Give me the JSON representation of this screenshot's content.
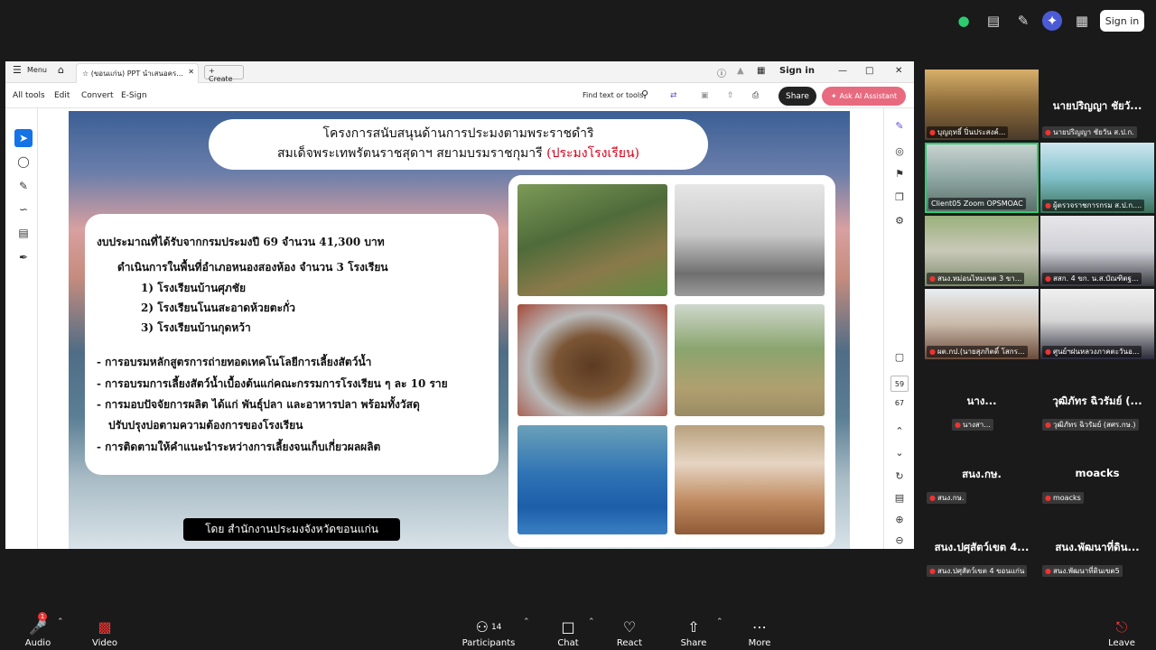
{
  "zoom_top": {
    "sign_in": "Sign in"
  },
  "acrobat": {
    "menu": "Menu",
    "tab_title": "(ขอนแก่น) PPT นำเสนอคร...",
    "create": "Create",
    "sign_in": "Sign in",
    "all_tools": "All tools",
    "edit": "Edit",
    "convert": "Convert",
    "esign": "E-Sign",
    "find": "Find text or tools",
    "share": "Share",
    "ai_assistant": "Ask AI Assistant",
    "page_number": "59",
    "page_total": "67"
  },
  "slide": {
    "title_line1": "โครงการสนับสนุนด้านการประมงตามพระราชดำริ",
    "title_line2": "สมเด็จพระเทพรัตนราชสุดาฯ สยามบรมราชกุมารี",
    "title_red": "(ประมงโรงเรียน)",
    "budget": "งบประมาณที่ได้รับจากกรมประมงปี 69  จำนวน 41,300 บาท",
    "area": "ดำเนินการในพื้นที่อำเภอหนองสองห้อง จำนวน 3 โรงเรียน",
    "school1": "1) โรงเรียนบ้านศุภชัย",
    "school2": "2) โรงเรียนโนนสะอาดห้วยตะกั่ว",
    "school3": "3) โรงเรียนบ้านกุดหว้า",
    "act1": "- การอบรมหลักสูตรการถ่ายทอดเทคโนโลยีการเลี้ยงสัตว์น้ำ",
    "act2": "- การอบรมการเลี้ยงสัตว์น้ำเบื้องต้นแก่คณะกรรมการโรงเรียน ๆ ละ 10 ราย",
    "act3": "- การมอบปัจจัยการผลิต ได้แก่ พันธุ์ปลา และอาหารปลา พร้อมทั้งวัสดุ",
    "act3b": "ปรับปรุงบ่อตามความต้องการของโรงเรียน",
    "act4": "- การติดตามให้คำแนะนำระหว่างการเลี้ยงจนเก็บเกี่ยวผลผลิต",
    "credit": "โดย สำนักงานประมงจังหวัดขอนแก่น"
  },
  "participants": [
    {
      "label": "บุญฤทธิ์ ปิ่นประสงค์..."
    },
    {
      "big": "นายปริญญา ชัยวั...",
      "label": "นายปริญญา ชัยวัน ส.ป.ก."
    },
    {
      "label": "Client05 Zoom OPSMOAC"
    },
    {
      "label": "ผู้ตรวจราชการกรม ส.ป.ก...."
    },
    {
      "label": "สนง.หม่อนไหมเขต 3 ขา..."
    },
    {
      "label": "สสก. 4 ขก. น.ส.บัณฑิตฐ..."
    },
    {
      "label": "ผต.กป.(นายสุภกิตติ์ โสกร..."
    },
    {
      "label": "ศูนย์ฯฝนหลวงภาคตะวันอ..."
    },
    {
      "big": "นาง...",
      "label": "นางสา..."
    },
    {
      "big": "วุฒิภัทร ฉิวรัมย์ (...",
      "label": "วุฒิภัทร ฉิวรัมย์ (สศร.กษ.)"
    },
    {
      "big": "สนง.กษ.",
      "label": "สนง.กษ."
    },
    {
      "big": "moacks",
      "label": "moacks"
    },
    {
      "big": "สนง.ปศุสัตว์เขต 4...",
      "label": "สนง.ปศุสัตว์เขต 4 ขอนแก่น"
    },
    {
      "big": "สนง.พัฒนาที่ดิน...",
      "label": "สนง.พัฒนาที่ดินเขต5"
    }
  ],
  "bottom": {
    "audio": "Audio",
    "video": "Video",
    "participants": "Participants",
    "participants_count": "14",
    "chat": "Chat",
    "react": "React",
    "share": "Share",
    "more": "More",
    "leave": "Leave",
    "audio_badge": "1"
  }
}
